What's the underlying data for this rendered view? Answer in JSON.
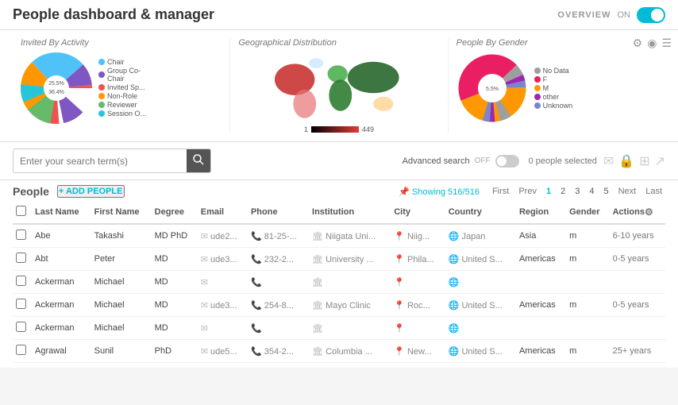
{
  "header": {
    "title": "People dashboard & manager",
    "overview_label": "OVERVIEW",
    "on_label": "ON"
  },
  "charts": {
    "invited_by_activity": {
      "title": "Invited By Activity",
      "legend": [
        {
          "label": "Chair",
          "color": "#4fc3f7"
        },
        {
          "label": "Group Co-Chair",
          "color": "#7e57c2"
        },
        {
          "label": "Invited Sp...",
          "color": "#ef5350"
        },
        {
          "label": "Non-Role",
          "color": "#ff9800"
        },
        {
          "label": "Reviewer",
          "color": "#66bb6a"
        },
        {
          "label": "Session O...",
          "color": "#26c6da"
        }
      ],
      "slices": [
        {
          "pct": 25.5,
          "color": "#4fc3f7",
          "start": 0
        },
        {
          "pct": 10,
          "color": "#7e57c2"
        },
        {
          "pct": 8,
          "color": "#ef5350"
        },
        {
          "pct": 36.4,
          "color": "#ff9800"
        },
        {
          "pct": 12,
          "color": "#66bb6a"
        },
        {
          "pct": 8.1,
          "color": "#26c6da"
        }
      ],
      "center_labels": [
        "25.5%",
        "36.4%"
      ]
    },
    "geographical": {
      "title": "Geographical Distribution",
      "scale_min": "1",
      "scale_max": "449"
    },
    "people_by_gender": {
      "title": "People By Gender",
      "legend": [
        {
          "label": "No Data",
          "color": "#9e9e9e"
        },
        {
          "label": "F",
          "color": "#e91e63"
        },
        {
          "label": "M",
          "color": "#ff9800"
        },
        {
          "label": "other",
          "color": "#9c27b0"
        },
        {
          "label": "Unknown",
          "color": "#7986cb"
        }
      ],
      "slices": [
        {
          "pct": 5.5,
          "color": "#9e9e9e"
        },
        {
          "pct": 44,
          "color": "#e91e63"
        },
        {
          "pct": 44,
          "color": "#ff9800"
        },
        {
          "pct": 3,
          "color": "#9c27b0"
        },
        {
          "pct": 3.5,
          "color": "#7986cb"
        }
      ]
    }
  },
  "search": {
    "placeholder": "Enter your search term(s)",
    "advanced_label": "Advanced search",
    "advanced_state": "OFF",
    "selected_count": "0 people selected"
  },
  "people": {
    "label": "People",
    "add_label": "+ ADD PEOPLE",
    "showing": "Showing 516/516",
    "pagination": {
      "first": "First",
      "prev": "Prev",
      "pages": [
        "1",
        "2",
        "3",
        "4",
        "5"
      ],
      "next": "Next",
      "last": "Last",
      "active": "1"
    }
  },
  "table": {
    "columns": [
      "Last Name",
      "First Name",
      "Degree",
      "Email",
      "Phone",
      "Institution",
      "City",
      "Country",
      "Region",
      "Gender",
      "Actions"
    ],
    "rows": [
      {
        "last": "Abe",
        "first": "Takashi",
        "degree": "MD PhD",
        "email": "ude2...",
        "phone": "81-25-...",
        "institution": "Niigata Uni...",
        "city": "Niig...",
        "country": "Japan",
        "region": "Asia",
        "gender": "m",
        "actions": "6-10 years"
      },
      {
        "last": "Abt",
        "first": "Peter",
        "degree": "MD",
        "email": "ude3...",
        "phone": "232-2...",
        "institution": "University ...",
        "city": "Phila...",
        "country": "United S...",
        "region": "Americas",
        "gender": "m",
        "actions": "0-5 years"
      },
      {
        "last": "Ackerman",
        "first": "Michael",
        "degree": "MD",
        "email": "",
        "phone": "",
        "institution": "",
        "city": "",
        "country": "",
        "region": "",
        "gender": "",
        "actions": ""
      },
      {
        "last": "Ackerman",
        "first": "Michael",
        "degree": "MD",
        "email": "ude3...",
        "phone": "254-8...",
        "institution": "Mayo Clinic",
        "city": "Roc...",
        "country": "United S...",
        "region": "Americas",
        "gender": "m",
        "actions": "0-5 years"
      },
      {
        "last": "Ackerman",
        "first": "Michael",
        "degree": "MD",
        "email": "",
        "phone": "",
        "institution": "",
        "city": "",
        "country": "",
        "region": "",
        "gender": "",
        "actions": ""
      },
      {
        "last": "Agrawal",
        "first": "Sunil",
        "degree": "PhD",
        "email": "ude5...",
        "phone": "354-2...",
        "institution": "Columbia ...",
        "city": "New...",
        "country": "United S...",
        "region": "Americas",
        "gender": "m",
        "actions": "25+ years"
      }
    ]
  }
}
